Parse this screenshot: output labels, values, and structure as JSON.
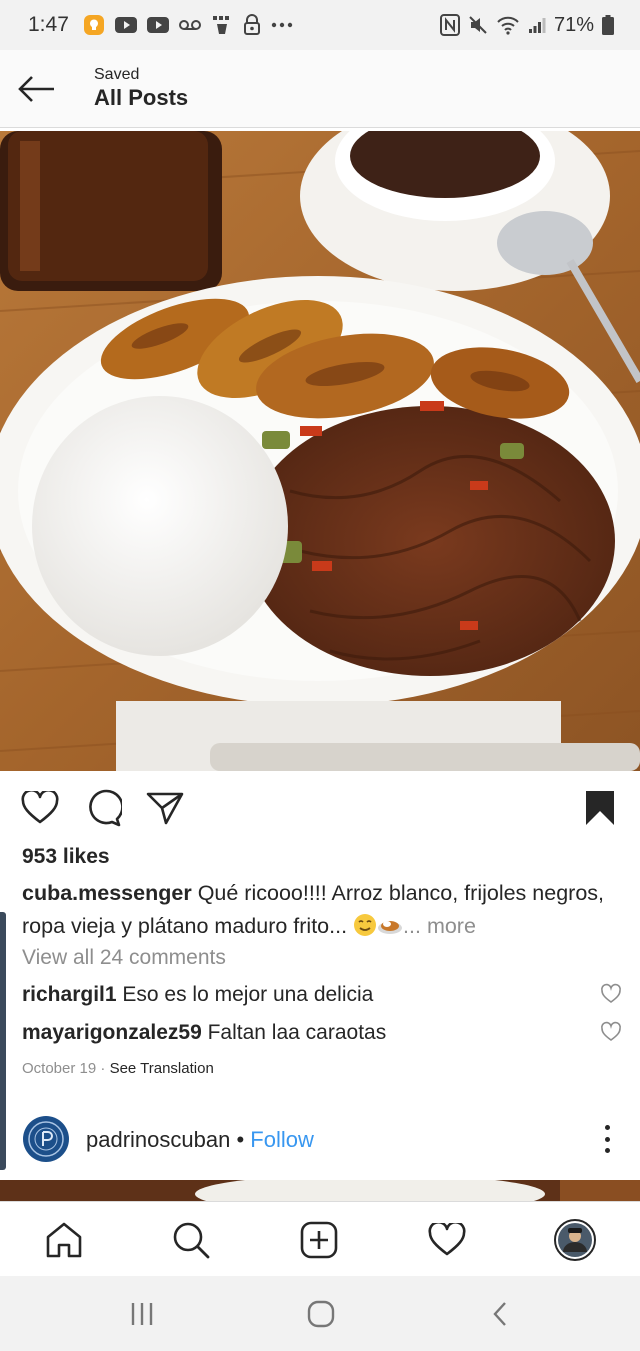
{
  "status_bar": {
    "time": "1:47",
    "battery_percent": "71%"
  },
  "header": {
    "subtitle": "Saved",
    "title": "All Posts"
  },
  "post": {
    "likes": "953 likes",
    "caption_user": "cuba.messenger",
    "caption_text": "Qué ricooo!!!! Arroz blanco, frijoles negros, ropa vieja y plátano maduro frito... ",
    "caption_more": "... more",
    "view_comments": "View all 24 comments",
    "comments": [
      {
        "user": "richargil1",
        "text": "Eso es lo mejor una delicia"
      },
      {
        "user": "mayarigonzalez59",
        "text": "Faltan laa caraotas"
      }
    ],
    "date": "October 19",
    "separator": " · ",
    "translate": "See Translation",
    "saved": true
  },
  "next_post": {
    "user": "padrinoscuban",
    "separator": " • ",
    "follow": "Follow"
  },
  "bottom_nav": [
    "home-icon",
    "search-icon",
    "new-post-icon",
    "activity-heart-icon",
    "profile-avatar"
  ],
  "colors": {
    "link": "#3897f0",
    "muted": "#8e8e8e",
    "text": "#262626"
  }
}
